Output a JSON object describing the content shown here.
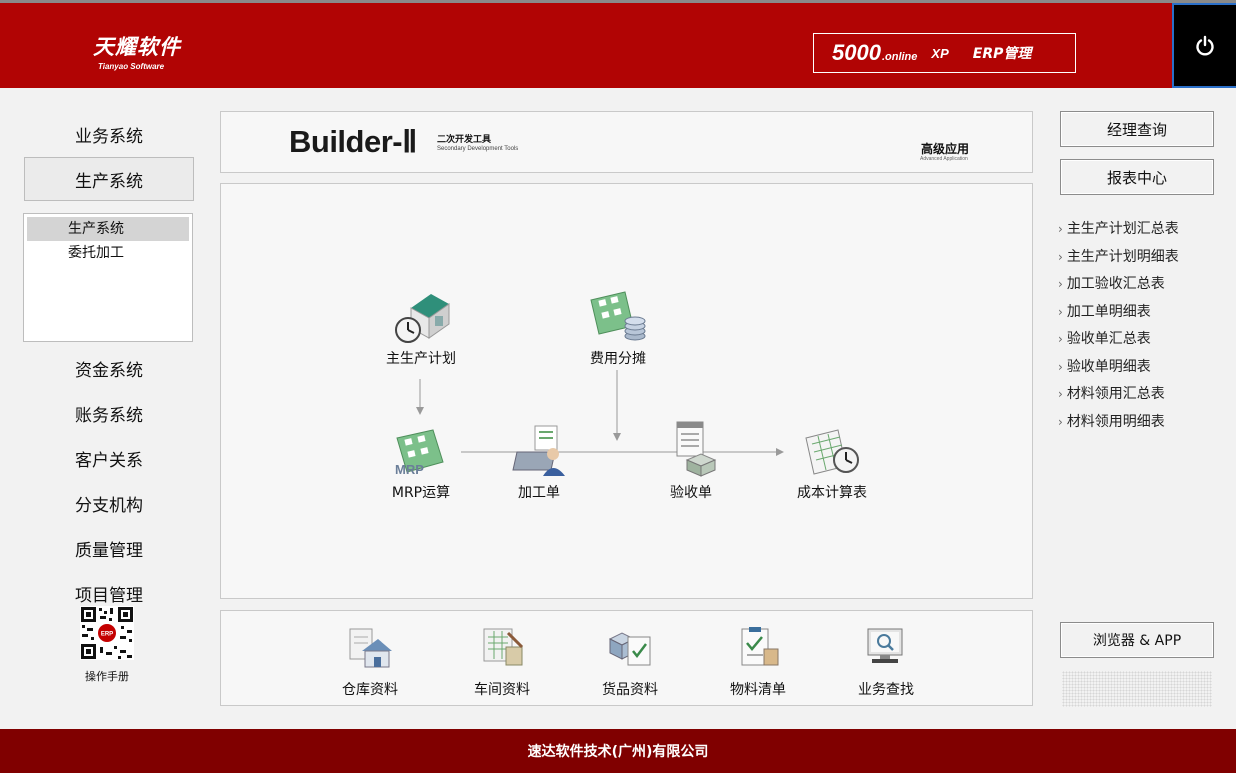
{
  "header": {
    "logo_cn": "天耀软件",
    "logo_en": "Tianyao Software",
    "product_num": "5000",
    "product_online": ".online",
    "product_xp": "XP",
    "product_erp": "ERP管理",
    "power_icon": "power-icon"
  },
  "left_nav": {
    "items": [
      {
        "label": "业务系统"
      },
      {
        "label": "生产系统",
        "active": true
      },
      {
        "label": "资金系统"
      },
      {
        "label": "账务系统"
      },
      {
        "label": "客户关系"
      },
      {
        "label": "分支机构"
      },
      {
        "label": "质量管理"
      },
      {
        "label": "项目管理"
      }
    ],
    "sub_items": [
      {
        "label": "生产系统",
        "selected": true
      },
      {
        "label": "委托加工"
      }
    ],
    "qr_badge": "ERP",
    "qr_label": "操作手册"
  },
  "banner": {
    "title": "Builder-Ⅱ",
    "subtitle_cn": "二次开发工具",
    "subtitle_en": "Secondary Development Tools",
    "advanced_cn": "高级应用",
    "advanced_en": "Advanced Application"
  },
  "flow": {
    "nodes": [
      {
        "id": "master-plan",
        "label": "主生产计划",
        "icon": "factory-clock-icon"
      },
      {
        "id": "cost-allocation",
        "label": "费用分摊",
        "icon": "calculator-coins-icon"
      },
      {
        "id": "mrp",
        "label": "MRP运算",
        "icon": "mrp-calculator-icon"
      },
      {
        "id": "work-order",
        "label": "加工单",
        "icon": "worker-icon"
      },
      {
        "id": "acceptance",
        "label": "验收单",
        "icon": "checklist-box-icon"
      },
      {
        "id": "costing",
        "label": "成本计算表",
        "icon": "spreadsheet-clock-icon"
      }
    ]
  },
  "tools": [
    {
      "label": "仓库资料",
      "icon": "warehouse-icon"
    },
    {
      "label": "车间资料",
      "icon": "workshop-icon"
    },
    {
      "label": "货品资料",
      "icon": "goods-icon"
    },
    {
      "label": "物料清单",
      "icon": "bom-clipboard-icon"
    },
    {
      "label": "业务查找",
      "icon": "search-monitor-icon"
    }
  ],
  "right": {
    "manager_query": "经理查询",
    "report_center": "报表中心",
    "chevron": "›",
    "reports": [
      "主生产计划汇总表",
      "主生产计划明细表",
      "加工验收汇总表",
      "加工单明细表",
      "验收单汇总表",
      "验收单明细表",
      "材料领用汇总表",
      "材料领用明细表"
    ],
    "browser_app": "浏览器 & APP"
  },
  "footer": {
    "company": "速达软件技术(广州)有限公司"
  },
  "colors": {
    "header_red": "#b10404",
    "footer_red": "#800000",
    "panel_bg": "#f7f7f7"
  }
}
